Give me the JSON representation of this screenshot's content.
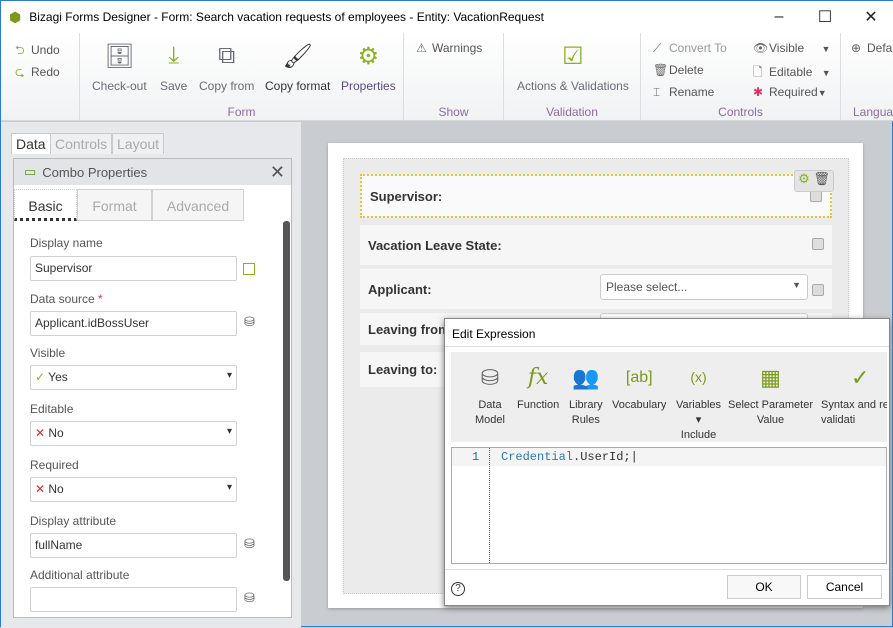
{
  "window": {
    "title": "Bizagi Forms Designer  - Form: Search vacation requests of employees - Entity:  VacationRequest",
    "minimize": "–",
    "maximize": "☐",
    "close": "✕"
  },
  "ribbon": {
    "undo": "Undo",
    "redo": "Redo",
    "form": {
      "label": "Form",
      "items": [
        "Check-out",
        "Save",
        "Copy from",
        "Copy format",
        "Properties"
      ]
    },
    "show": {
      "label": "Show",
      "warnings": "Warnings"
    },
    "validation": {
      "label": "Validation",
      "actions": "Actions & Validations"
    },
    "controls": {
      "label": "Controls",
      "convert": "Convert To",
      "delete": "Delete",
      "rename": "Rename",
      "visible": "Visible",
      "editable": "Editable",
      "required": "Required"
    },
    "language": {
      "label": "Langua",
      "default": "Defa"
    }
  },
  "left": {
    "tabs": [
      "Data",
      "Controls",
      "Layout"
    ],
    "panel_title": "Combo Properties",
    "prop_tabs": [
      "Basic",
      "Format",
      "Advanced"
    ],
    "fields": {
      "display_name": {
        "label": "Display name",
        "value": "Supervisor"
      },
      "data_source": {
        "label": "Data source",
        "required": "*",
        "value": "Applicant.idBossUser"
      },
      "visible": {
        "label": "Visible",
        "value": "Yes"
      },
      "editable": {
        "label": "Editable",
        "value": "No"
      },
      "required": {
        "label": "Required",
        "value": "No"
      },
      "display_attribute": {
        "label": "Display attribute",
        "value": "fullName"
      },
      "additional_attribute": {
        "label": "Additional attribute",
        "value": ""
      }
    }
  },
  "form": {
    "rows": [
      {
        "label": "Supervisor:"
      },
      {
        "label": "Vacation Leave State:"
      },
      {
        "label": "Applicant:",
        "placeholder": "Please select..."
      },
      {
        "label": "Leaving from:"
      },
      {
        "label": "Leaving to:"
      }
    ]
  },
  "dialog": {
    "title": "Edit Expression",
    "tools": [
      {
        "label": "Data\nModel"
      },
      {
        "label": "Function"
      },
      {
        "label": "Library\nRules"
      },
      {
        "label": "Vocabulary"
      },
      {
        "label": "Variables\n▾\nInclude"
      },
      {
        "label": "Select Parameter\nValue"
      },
      {
        "label": "Syntax and re\nvalidati"
      }
    ],
    "line_number": "1",
    "code_object": "Credential",
    "code_rest": ".UserId;",
    "ok": "OK",
    "cancel": "Cancel",
    "help": "?"
  },
  "colors": {
    "accent": "#8ab21c",
    "selection": "#f0c030",
    "label_purple": "#8a6d9c"
  }
}
